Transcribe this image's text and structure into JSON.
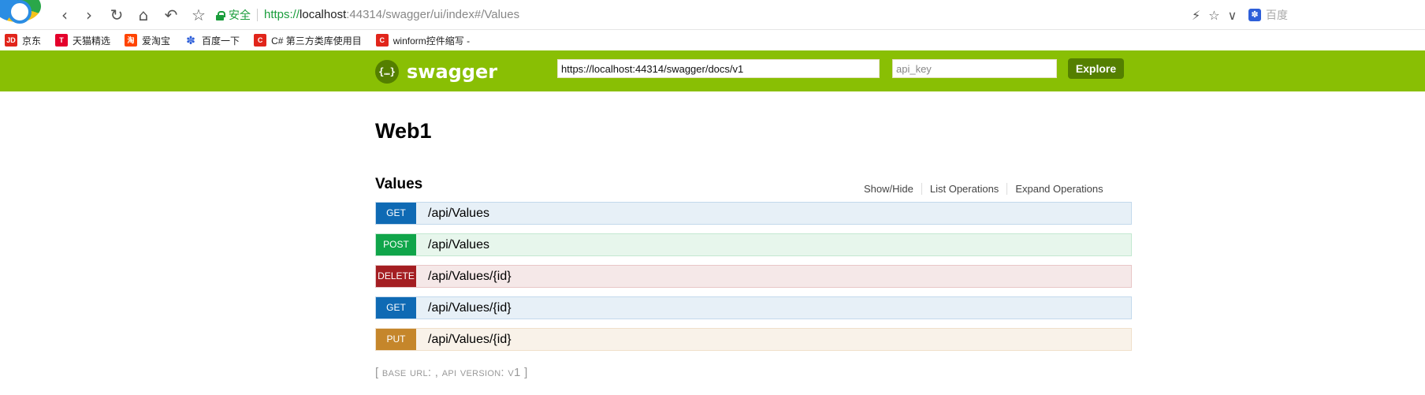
{
  "browser": {
    "nav": {
      "back": "‹",
      "forward": "›",
      "reload": "↻",
      "home": "⌂",
      "undo": "↶",
      "favorite": "☆"
    },
    "secure_label": "安全",
    "url_proto": "https://",
    "url_host": "localhost",
    "url_rest": ":44314/swagger/ui/index#/Values",
    "tools": {
      "lightning": "⚡",
      "star": "☆",
      "dropdown": "∨"
    },
    "search_engine": "百度"
  },
  "bookmarks": [
    {
      "icon": "JD",
      "label": "京东",
      "kind": "jd"
    },
    {
      "icon": "T",
      "label": "天猫精选",
      "kind": "tmall"
    },
    {
      "icon": "淘",
      "label": "爱淘宝",
      "kind": "taobao"
    },
    {
      "icon": "✽",
      "label": "百度一下",
      "kind": "baidu"
    },
    {
      "icon": "C",
      "label": "C# 第三方类库使用目",
      "kind": "cnblogs"
    },
    {
      "icon": "C",
      "label": "winform控件缩写 - ",
      "kind": "cnblogs"
    }
  ],
  "swagger": {
    "logo_icon": "{…}",
    "logo_text": "swagger",
    "url_value": "https://localhost:44314/swagger/docs/v1",
    "api_key_placeholder": "api_key",
    "explore_label": "Explore",
    "brand_color": "#89bf04"
  },
  "page": {
    "title": "Web1",
    "resource": "Values",
    "actions": [
      "Show/Hide",
      "List Operations",
      "Expand Operations"
    ]
  },
  "operations": [
    {
      "method": "GET",
      "path": "/api/Values"
    },
    {
      "method": "POST",
      "path": "/api/Values"
    },
    {
      "method": "DELETE",
      "path": "/api/Values/{id}"
    },
    {
      "method": "GET",
      "path": "/api/Values/{id}"
    },
    {
      "method": "PUT",
      "path": "/api/Values/{id}"
    }
  ],
  "footer": {
    "text": "[ base url: , api version: v1 ]"
  }
}
